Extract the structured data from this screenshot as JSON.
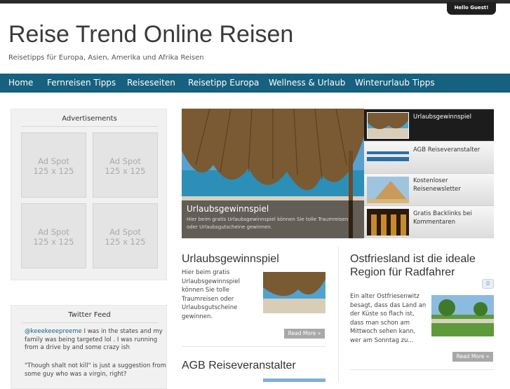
{
  "header": {
    "greeting": "Hello Guest!",
    "site_title": "Reise Trend Online Reisen",
    "tagline": "Reisetipps für Europa, Asien, Amerika und Afrika Reisen"
  },
  "nav": {
    "items": [
      {
        "label": "Home"
      },
      {
        "label": "Fernreisen Tipps"
      },
      {
        "label": "Reiseseiten"
      },
      {
        "label": "Reisetipp Europa"
      },
      {
        "label": "Wellness & Urlaub"
      },
      {
        "label": "Winterurlaub Tipps"
      }
    ]
  },
  "sidebar": {
    "ads": {
      "title": "Advertisements",
      "spots": [
        {
          "line1": "Ad Spot",
          "line2": "125 x 125"
        },
        {
          "line1": "Ad Spot",
          "line2": "125 x 125"
        },
        {
          "line1": "Ad Spot",
          "line2": "125 x 125"
        },
        {
          "line1": "Ad Spot",
          "line2": "125 x 125"
        }
      ]
    },
    "twitter": {
      "title": "Twitter Feed",
      "tweets": [
        {
          "user": "@keeekeeepreeme",
          "text": " I was in the states and my family was being targeted lol . I was running from a drive by and some crazy ish"
        },
        {
          "user": "",
          "text": "\"Though shalt not kill\" is just a suggestion from some guy who was a virgin, right?"
        }
      ]
    }
  },
  "slider": {
    "caption_title": "Urlaubsgewinnspiel",
    "caption_text": "Hier beim gratis Urlaubsgewinnspiel können Sie tolle Traumreisen oder Urlaubsgutscheine gewinnen.",
    "thumbs": [
      {
        "label": "Urlaubsgewinnspiel"
      },
      {
        "label": "AGB Reiseveranstalter"
      },
      {
        "label": "Kostenloser Reisenewsletter"
      },
      {
        "label": "Gratis Backlinks bei Kommentaren"
      }
    ]
  },
  "posts": [
    {
      "title": "Urlaubsgewinnspiel",
      "text": "Hier beim gratis Urlaubsgewinnspiel können Sie tolle Traumreisen oder Urlaubsgutscheine gewinnen.",
      "more": "Read More »"
    },
    {
      "title": "Ostfriesland ist die ideale Region für Radfahrer",
      "text": "Ein alter Ostfriesenwitz besagt, dass das Land an der Küste so flach ist, dass man schon am Mittwoch sehen kann, wer am Sonntag zu...",
      "more": "Read More »",
      "comments": "0"
    },
    {
      "title": "AGB Reiseveranstalter"
    }
  ]
}
